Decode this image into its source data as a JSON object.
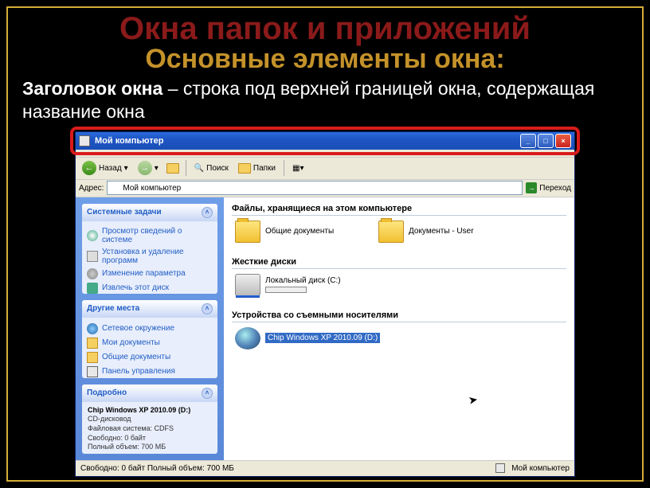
{
  "slide": {
    "title": "Окна папок и приложений",
    "subtitle": "Основные элементы окна:",
    "def_term": "Заголовок окна",
    "def_dash": " – ",
    "def_text": "строка под верхней границей окна, содержащая название окна"
  },
  "titlebar": {
    "title": "Мой компьютер"
  },
  "toolbar": {
    "back": "Назад",
    "search": "Поиск",
    "folders": "Папки"
  },
  "address": {
    "label": "Адрес:",
    "value": "Мой компьютер",
    "go": "Переход"
  },
  "sidebar": {
    "panel1_title": "Системные задачи",
    "panel1_items": [
      "Просмотр сведений о системе",
      "Установка и удаление программ",
      "Изменение параметра",
      "Извлечь этот диск"
    ],
    "panel2_title": "Другие места",
    "panel2_items": [
      "Сетевое окружение",
      "Мои документы",
      "Общие документы",
      "Панель управления"
    ],
    "panel3_title": "Подробно",
    "detail_title": "Chip Windows XP 2010.09 (D:)",
    "detail_lines": [
      "CD-дисковод",
      "Файловая система: CDFS",
      "Свободно: 0 байт",
      "Полный объем: 700 МБ"
    ]
  },
  "content": {
    "group1": "Файлы, хранящиеся на этом компьютере",
    "g1_items": [
      "Общие документы",
      "Документы - User"
    ],
    "group2": "Жесткие диски",
    "g2_item": "Локальный диск (C:)",
    "group3": "Устройства со съемными носителями",
    "g3_item": "Chip Windows XP 2010.09 (D:)"
  },
  "statusbar": {
    "left": "Свободно: 0 байт Полный объем: 700 МБ",
    "right": "Мой компьютер"
  }
}
